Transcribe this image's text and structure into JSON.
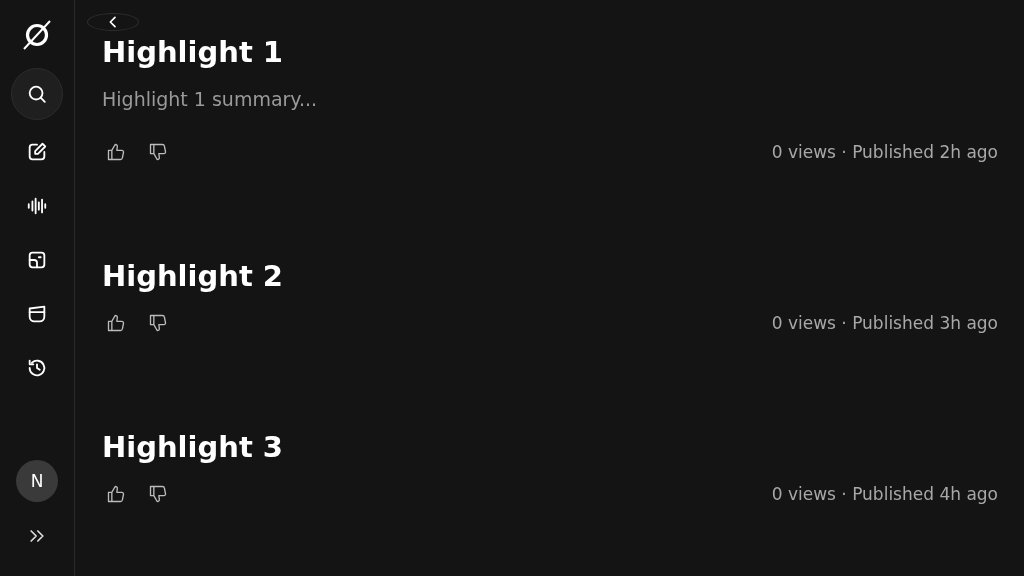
{
  "sidebar": {
    "nav": [
      {
        "kind": "search",
        "selected": true
      },
      {
        "kind": "edit",
        "selected": false
      },
      {
        "kind": "audio",
        "selected": false
      },
      {
        "kind": "image",
        "selected": false
      },
      {
        "kind": "folder",
        "selected": false
      },
      {
        "kind": "history",
        "selected": false
      }
    ],
    "avatar": "N"
  },
  "highlights": [
    {
      "title": "Highlight 1",
      "summary": "Highlight 1 summary...",
      "meta": "0 views · Published 2h ago"
    },
    {
      "title": "Highlight 2",
      "meta": "0 views · Published 3h ago"
    },
    {
      "title": "Highlight 3",
      "meta": "0 views · Published 4h ago"
    }
  ]
}
